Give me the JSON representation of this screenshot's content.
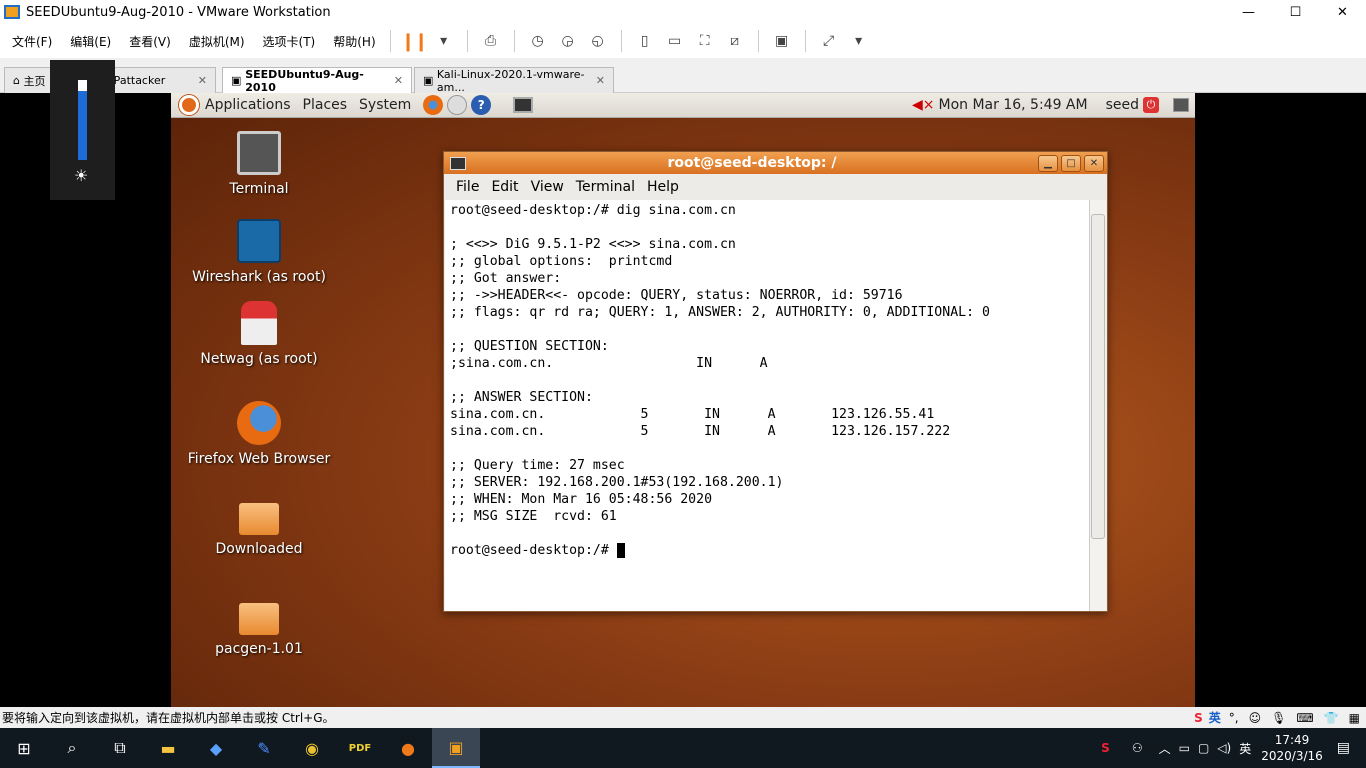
{
  "window": {
    "title": "SEEDUbuntu9-Aug-2010 - VMware Workstation",
    "min": "—",
    "max": "☐",
    "close": "✕"
  },
  "menu": [
    "文件(F)",
    "编辑(E)",
    "查看(V)",
    "虚拟机(M)",
    "选项卡(T)",
    "帮助(H)"
  ],
  "tabs": [
    {
      "label": "主页"
    },
    {
      "label": "WinXPattacker"
    },
    {
      "label": "SEEDUbuntu9-Aug-2010"
    },
    {
      "label": "Kali-Linux-2020.1-vmware-am..."
    }
  ],
  "guest_panel": {
    "menus": [
      "Applications",
      "Places",
      "System"
    ],
    "datetime": "Mon Mar 16,  5:49 AM",
    "user": "seed"
  },
  "desktop_icons": [
    {
      "label": "Terminal"
    },
    {
      "label": "Wireshark (as root)"
    },
    {
      "label": "Netwag (as root)"
    },
    {
      "label": "Firefox Web Browser"
    },
    {
      "label": "Downloaded"
    },
    {
      "label": "pacgen-1.01"
    }
  ],
  "terminal": {
    "title": "root@seed-desktop: /",
    "menu": [
      "File",
      "Edit",
      "View",
      "Terminal",
      "Help"
    ],
    "lines": [
      "root@seed-desktop:/# dig sina.com.cn",
      "",
      "; <<>> DiG 9.5.1-P2 <<>> sina.com.cn",
      ";; global options:  printcmd",
      ";; Got answer:",
      ";; ->>HEADER<<- opcode: QUERY, status: NOERROR, id: 59716",
      ";; flags: qr rd ra; QUERY: 1, ANSWER: 2, AUTHORITY: 0, ADDITIONAL: 0",
      "",
      ";; QUESTION SECTION:",
      ";sina.com.cn.                  IN      A",
      "",
      ";; ANSWER SECTION:",
      "sina.com.cn.            5       IN      A       123.126.55.41",
      "sina.com.cn.            5       IN      A       123.126.157.222",
      "",
      ";; Query time: 27 msec",
      ";; SERVER: 192.168.200.1#53(192.168.200.1)",
      ";; WHEN: Mon Mar 16 05:48:56 2020",
      ";; MSG SIZE  rcvd: 61",
      ""
    ],
    "prompt": "root@seed-desktop:/# "
  },
  "status_bar": {
    "message": "要将输入定向到该虚拟机，请在虚拟机内部单击或按 Ctrl+G。",
    "ime": "英"
  },
  "taskbar": {
    "time": "17:49",
    "date": "2020/3/16"
  }
}
